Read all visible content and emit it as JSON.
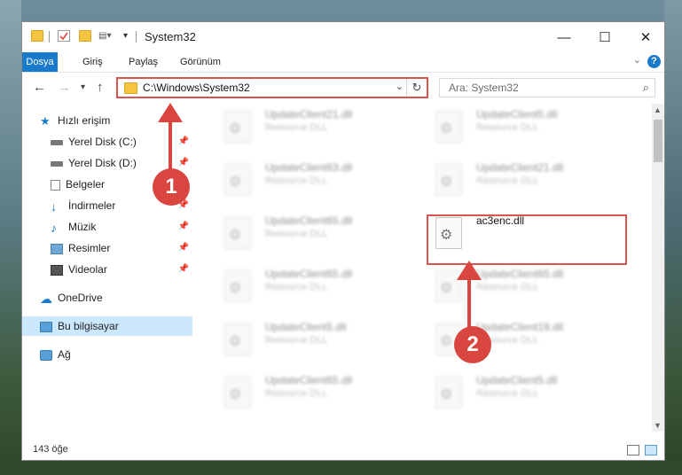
{
  "window": {
    "title": "System32",
    "minimize": "—",
    "maximize": "☐",
    "close": "✕"
  },
  "ribbon": {
    "tabs": [
      "Dosya",
      "Giriş",
      "Paylaş",
      "Görünüm"
    ],
    "active_tab": "Dosya",
    "help": "?"
  },
  "address": {
    "path": "C:\\Windows\\System32",
    "search_placeholder": "Ara: System32"
  },
  "navigation": {
    "items": [
      {
        "label": "Hızlı erişim",
        "icon": "star-icon"
      },
      {
        "label": "Yerel Disk (C:)",
        "icon": "drive-icon",
        "pinned": true
      },
      {
        "label": "Yerel Disk (D:)",
        "icon": "drive-icon",
        "pinned": true
      },
      {
        "label": "Belgeler",
        "icon": "documents-icon",
        "pinned": true
      },
      {
        "label": "İndirmeler",
        "icon": "download-icon",
        "pinned": true
      },
      {
        "label": "Müzik",
        "icon": "music-icon",
        "pinned": true
      },
      {
        "label": "Resimler",
        "icon": "pictures-icon",
        "pinned": true
      },
      {
        "label": "Videolar",
        "icon": "videos-icon",
        "pinned": true
      },
      {
        "label": "OneDrive",
        "icon": "cloud-icon"
      },
      {
        "label": "Bu bilgisayar",
        "icon": "computer-icon",
        "selected": true
      },
      {
        "label": "Ağ",
        "icon": "network-icon"
      }
    ]
  },
  "files": [
    {
      "name": "UpdateClient21.dll",
      "desc": "Resource DLL"
    },
    {
      "name": "UpdateClient5.dll",
      "desc": "Resource DLL"
    },
    {
      "name": "UpdateClient63.dll",
      "desc": "Resource DLL"
    },
    {
      "name": "UpdateClient21.dll",
      "desc": "Resource DLL"
    },
    {
      "name": "UpdateClient65.dll",
      "desc": "Resource DLL"
    },
    {
      "name": "ac3enc.dll",
      "desc": "",
      "highlighted": true
    },
    {
      "name": "UpdateClient65.dll",
      "desc": "Resource DLL"
    },
    {
      "name": "UpdateClient65.dll",
      "desc": "Resource DLL"
    },
    {
      "name": "UpdateClient5.dll",
      "desc": "Resource DLL"
    },
    {
      "name": "UpdateClient19.dll",
      "desc": "Resource DLL"
    },
    {
      "name": "UpdateClient65.dll",
      "desc": "Resource DLL"
    },
    {
      "name": "UpdateClient5.dll",
      "desc": "Resource DLL"
    }
  ],
  "status": {
    "count": "143 öğe"
  },
  "annotations": {
    "step1": "1",
    "step2": "2",
    "color": "#d9453f"
  }
}
